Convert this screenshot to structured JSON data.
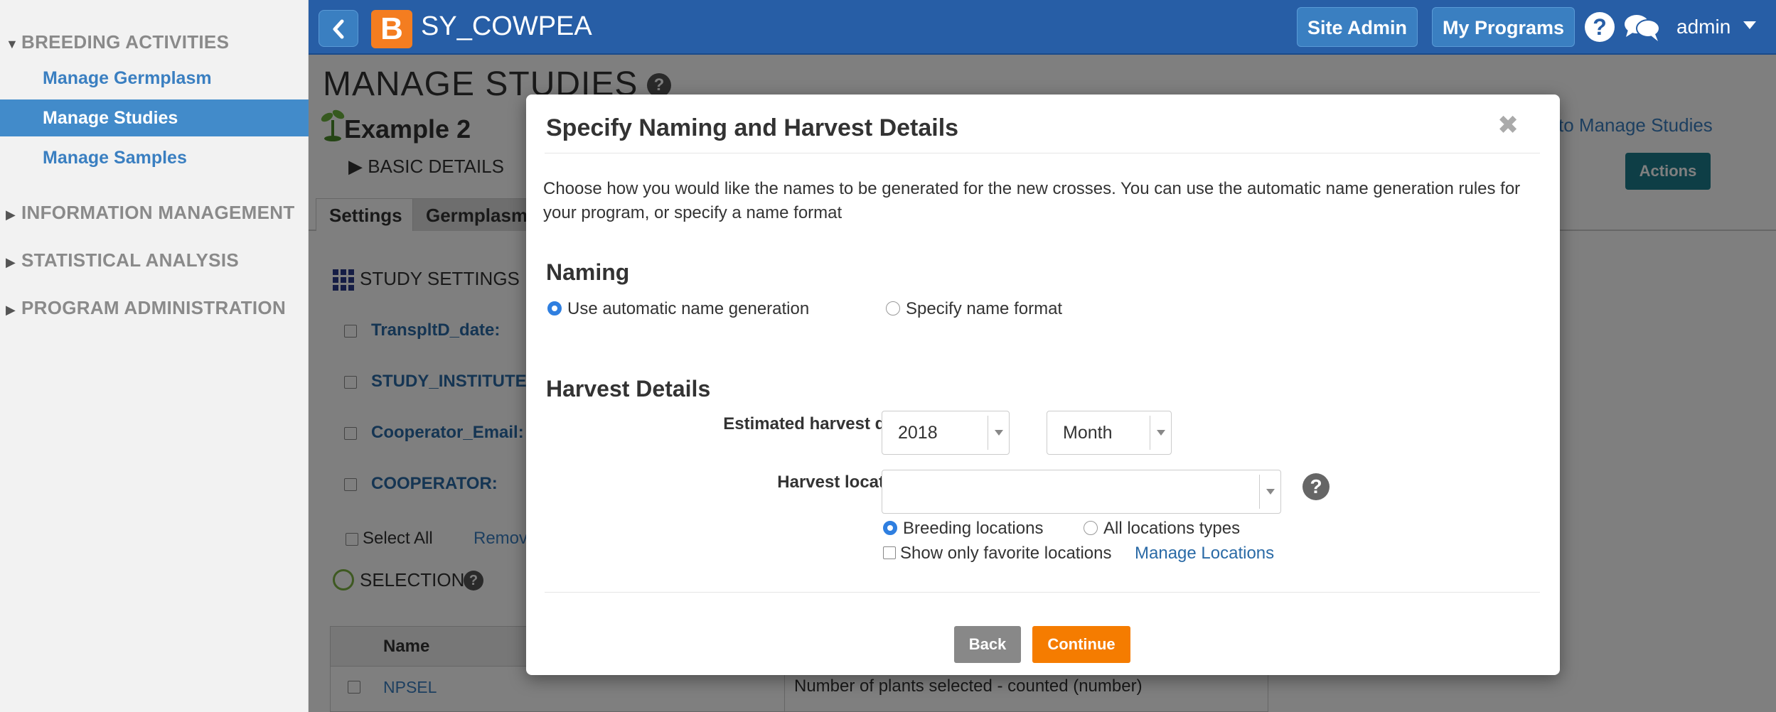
{
  "sidebar": {
    "sections": [
      {
        "label": "BREEDING ACTIVITIES",
        "expanded": true
      },
      {
        "label": "INFORMATION MANAGEMENT",
        "expanded": false
      },
      {
        "label": "STATISTICAL ANALYSIS",
        "expanded": false
      },
      {
        "label": "PROGRAM ADMINISTRATION",
        "expanded": false
      }
    ],
    "items": [
      {
        "label": "Manage Germplasm"
      },
      {
        "label": "Manage Studies",
        "active": true
      },
      {
        "label": "Manage Samples"
      }
    ]
  },
  "topbar": {
    "logo_letter": "B",
    "app_title": "SY_COWPEA",
    "site_admin": "Site Admin",
    "my_programs": "My Programs",
    "help": "?",
    "user": "admin"
  },
  "main": {
    "page_title": "MANAGE STUDIES",
    "study_name": "Example 2",
    "basic_details": "BASIC DETAILS",
    "back_link": "to Manage Studies",
    "actions_label": "Actions",
    "tabs": [
      {
        "label": "Settings"
      },
      {
        "label": "Germplasm"
      }
    ],
    "study_settings": "STUDY SETTINGS",
    "settings_rows": [
      "TranspltD_date:",
      "STUDY_INSTITUTE:",
      "Cooperator_Email:",
      "COOPERATOR:"
    ],
    "select_all": "Select All",
    "remove": "Remov",
    "selection": "SELECTION",
    "table": {
      "header_name": "Name",
      "rows": [
        {
          "name": "NPSEL",
          "description": "Number of plants selected - counted (number)"
        }
      ]
    }
  },
  "modal": {
    "title": "Specify Naming and Harvest Details",
    "close": "✖",
    "description": "Choose how you would like the names to be generated for the new crosses. You can use the automatic name generation rules for your program, or specify a name format",
    "naming_heading": "Naming",
    "naming_options": [
      "Use automatic name generation",
      "Specify name format"
    ],
    "naming_selected": 0,
    "harvest_heading": "Harvest Details",
    "harvest_date_label": "Estimated harvest date:",
    "harvest_year": "2018",
    "harvest_month": "Month",
    "harvest_location_label": "Harvest location:",
    "harvest_location_value": "",
    "location_options": [
      "Breeding locations",
      "All locations types"
    ],
    "location_selected": 0,
    "favorite_locations": "Show only favorite locations",
    "manage_locations": "Manage Locations",
    "back_button": "Back",
    "continue_button": "Continue"
  },
  "colors": {
    "topbar": "#275ea6",
    "accent": "#428bca",
    "continue": "#f57c00",
    "actions": "#1c7c8c"
  }
}
